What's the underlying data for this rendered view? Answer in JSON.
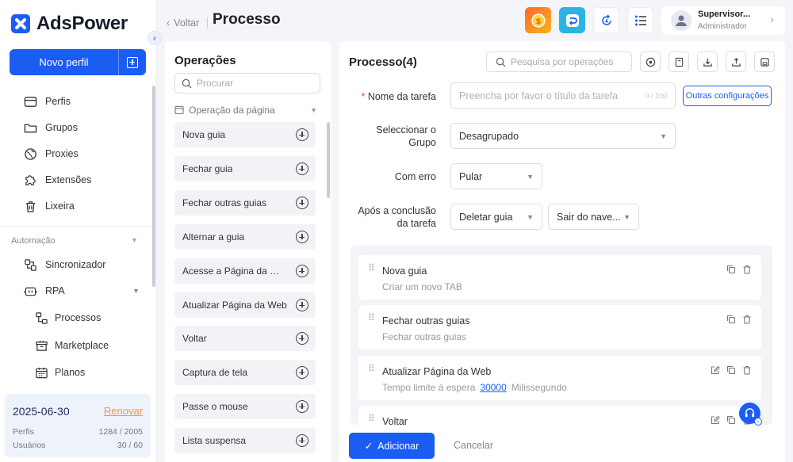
{
  "app": {
    "brand": "AdsPower",
    "accent": "#1b5cf2"
  },
  "header": {
    "back_label": "Voltar",
    "title": "Processo"
  },
  "user": {
    "name": "Supervisor...",
    "role": "Administrador"
  },
  "sidebar": {
    "new_profile_label": "Novo perfil",
    "items": [
      {
        "label": "Perfis",
        "icon": "profile-card-icon"
      },
      {
        "label": "Grupos",
        "icon": "folder-icon"
      },
      {
        "label": "Proxies",
        "icon": "globe-icon"
      },
      {
        "label": "Extensões",
        "icon": "puzzle-icon"
      },
      {
        "label": "Lixeira",
        "icon": "trash-icon"
      }
    ],
    "automation_label": "Automação",
    "automation_items": [
      {
        "label": "Sincronizador",
        "icon": "sync-icon"
      },
      {
        "label": "RPA",
        "icon": "robot-icon"
      }
    ],
    "rpa_sub": [
      {
        "label": "Processos",
        "icon": "flow-icon"
      },
      {
        "label": "Marketplace",
        "icon": "store-icon"
      },
      {
        "label": "Planos",
        "icon": "calendar-icon"
      }
    ],
    "plan": {
      "date": "2025-06-30",
      "renew_label": "Renovar",
      "profiles_label": "Perfis",
      "profiles_value": "1284 / 2005",
      "users_label": "Usuários",
      "users_value": "30 / 60"
    }
  },
  "operations": {
    "title": "Operações",
    "search_placeholder": "Procurar",
    "group_label": "Operação da página",
    "items": [
      "Nova guia",
      "Fechar guia",
      "Fechar outras guias",
      "Alternar a guia",
      "Acesse a Página da Web",
      "Atualizar Página da Web",
      "Voltar",
      "Captura de tela",
      "Passe o mouse",
      "Lista suspensa"
    ]
  },
  "process": {
    "title": "Processo(4)",
    "search_placeholder": "Pesquisa por operações",
    "task_name_label": "Nome da tarefa",
    "task_name_placeholder": "Preencha por favor o título da tarefa",
    "task_name_counter": "0 / 100",
    "other_config_label": "Outras configurações",
    "group_label_1": "Seleccionar o",
    "group_label_2": "Grupo",
    "group_value": "Desagrupado",
    "on_error_label": "Com erro",
    "on_error_value": "Pular",
    "after_label_1": "Após a conclusão",
    "after_label_2": "da tarefa",
    "after_value_1": "Deletar guia",
    "after_value_2": "Sair do nave...",
    "steps": [
      {
        "name": "Nova guia",
        "desc": "Criar um novo TAB"
      },
      {
        "name": "Fechar outras guias",
        "desc": "Fechar outras guias"
      },
      {
        "name": "Atualizar Página da Web",
        "desc_prefix": "Tempo limite à espera",
        "desc_value": "30000",
        "desc_suffix": "Milissegundo"
      },
      {
        "name": "Voltar"
      }
    ],
    "add_label": "Adicionar",
    "cancel_label": "Cancelar"
  }
}
